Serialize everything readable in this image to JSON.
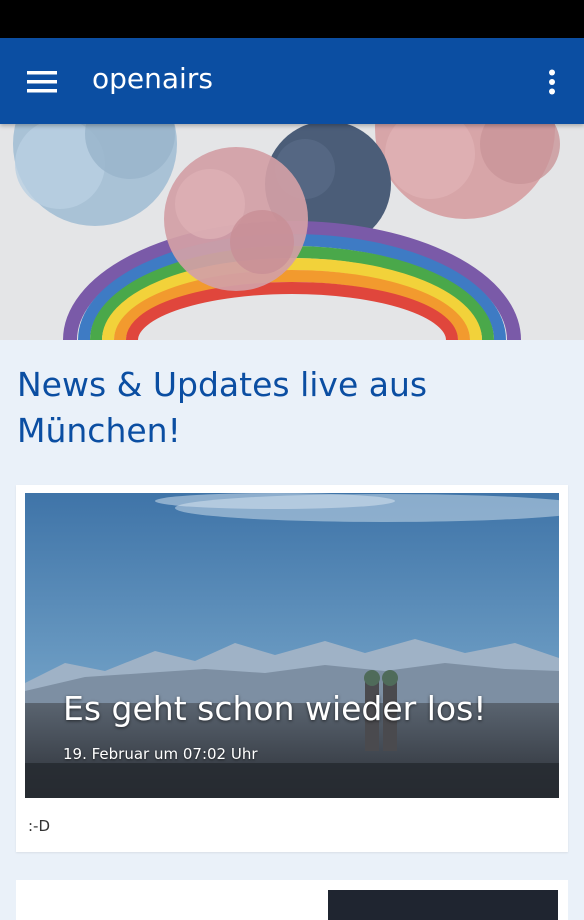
{
  "appbar": {
    "title": "openairs",
    "menu_icon": "hamburger-menu-icon",
    "overflow_icon": "more-vert-icon",
    "color": "#0b4ea2"
  },
  "headline": "News & Updates live aus München!",
  "posts": [
    {
      "title": "Es geht schon wieder los!",
      "date": "19. Februar um 07:02 Uhr",
      "excerpt": ":-D"
    }
  ]
}
